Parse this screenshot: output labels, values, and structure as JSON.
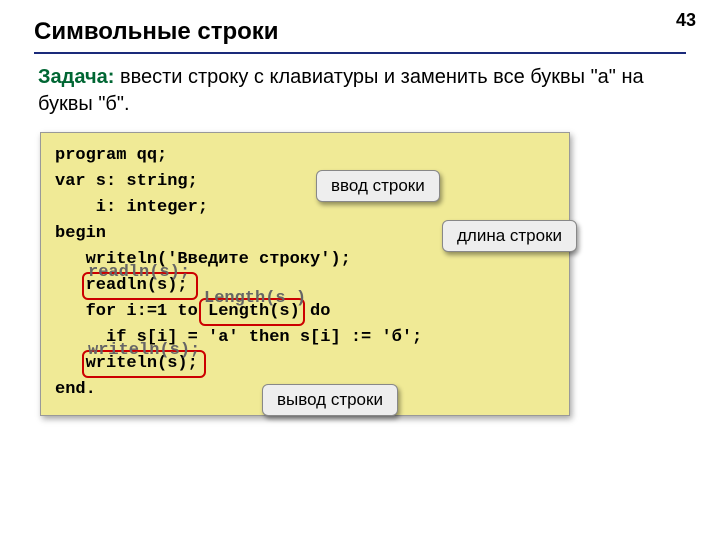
{
  "page_number": "43",
  "title": "Символьные строки",
  "task": {
    "label": "Задача:",
    "body": " ввести строку с клавиатуры и заменить все\n  буквы \"а\" на буквы \"б\"."
  },
  "code": {
    "text": "program qq;\nvar s: string;\n    i: integer;\nbegin\n   writeln('Введите строку');\n   readln(s);\n   for i:=1 to Length(s) do\n     if s[i] = 'а' then s[i] := 'б';\n   writeln(s);\nend."
  },
  "overlays": {
    "readln": "readln(s);",
    "length": "Length(s\n)",
    "writeln": "writeln(s);"
  },
  "callouts": {
    "input": "ввод строки",
    "length": "длина строки",
    "output": "вывод строки"
  }
}
